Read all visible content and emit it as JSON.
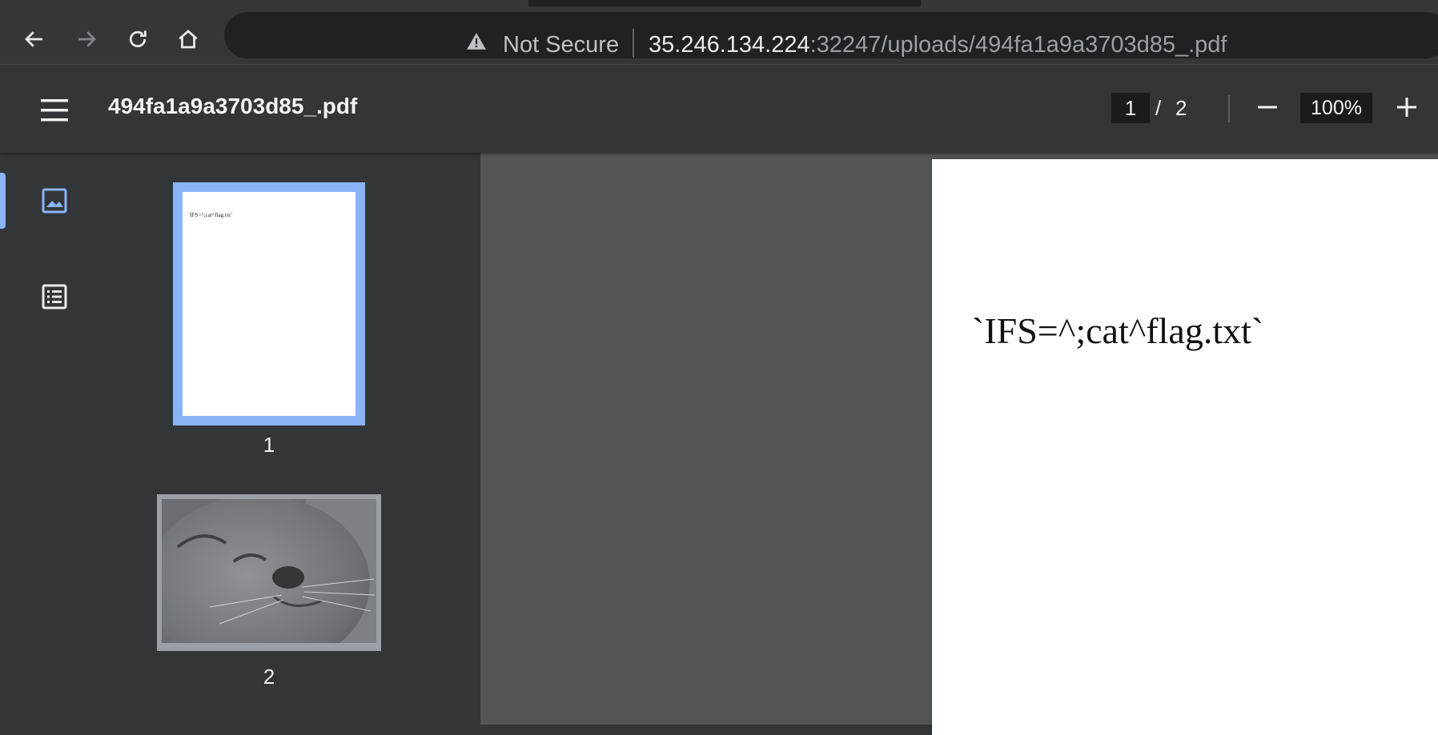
{
  "browser": {
    "security_label": "Not Secure",
    "url_host": "35.246.134.224",
    "url_path": ":32247/uploads/494fa1a9a3703d85_.pdf",
    "icons": [
      "back-icon",
      "forward-icon",
      "reload-icon",
      "home-icon",
      "warning-icon"
    ]
  },
  "pdf_toolbar": {
    "title": "494fa1a9a3703d85_.pdf",
    "current_page": "1",
    "page_separator": "/",
    "total_pages": "2",
    "zoom": "100%",
    "icons": [
      "menu-icon",
      "zoom-out-icon",
      "zoom-in-icon"
    ]
  },
  "sidebar": {
    "icons": [
      "thumbnails-icon",
      "outline-icon"
    ],
    "thumbnails": [
      {
        "label": "1",
        "preview_text": "`IFS=^;cat^flag.txt`",
        "selected": true
      },
      {
        "label": "2",
        "preview": "seal photo",
        "selected": false
      }
    ]
  },
  "document": {
    "page1_text": "`IFS=^;cat^flag.txt`"
  },
  "colors": {
    "accent": "#8ab4f8",
    "toolbar_bg": "#323639",
    "viewer_bg": "#525659",
    "omnibox_bg": "#202124"
  }
}
